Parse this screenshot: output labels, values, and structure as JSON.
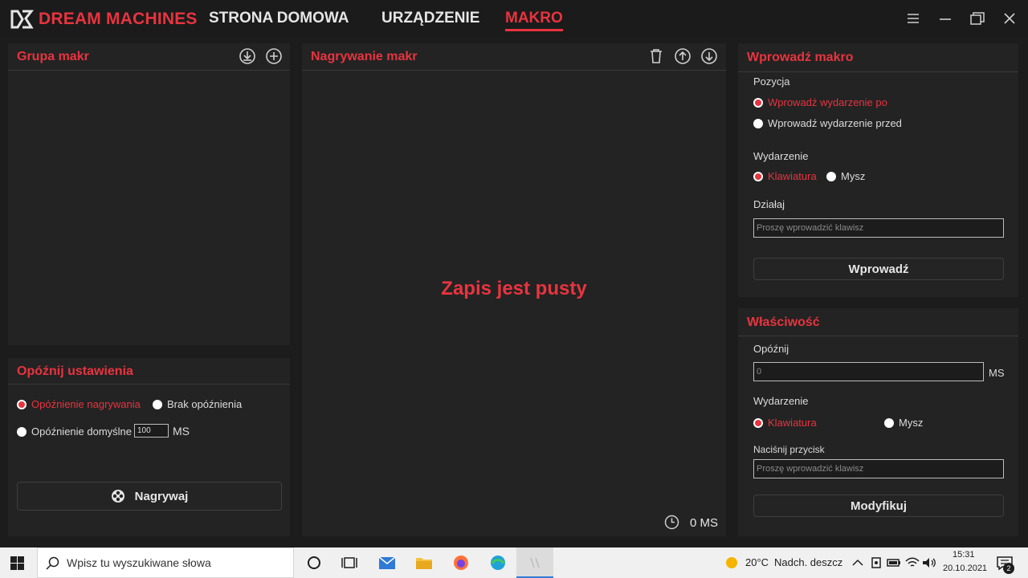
{
  "app": {
    "brand": "DREAM MACHINES",
    "nav": [
      "STRONA DOMOWA",
      "URZĄDZENIE",
      "MAKRO"
    ],
    "active_nav": "MAKRO"
  },
  "macro_group": {
    "title": "Grupa makr"
  },
  "delay_settings": {
    "title": "Opóźnij ustawienia",
    "opt_record_delay": "Opóźnienie nagrywania",
    "opt_no_delay": "Brak opóźnienia",
    "opt_default_delay": "Opóźnienie domyślne",
    "default_delay_value": "100",
    "unit": "MS",
    "record_button": "Nagrywaj"
  },
  "macro_recording": {
    "title": "Nagrywanie makr",
    "empty_message": "Zapis jest pusty",
    "time_value": "0 MS"
  },
  "insert_macro": {
    "title": "Wprowadź makro",
    "position_label": "Pozycja",
    "opt_after": "Wprowadź wydarzenie po",
    "opt_before": "Wprowadź wydarzenie przed",
    "event_label": "Wydarzenie",
    "opt_keyboard": "Klawiatura",
    "opt_mouse": "Mysz",
    "action_label": "Działaj",
    "key_placeholder": "Proszę wprowadzić klawisz",
    "insert_button": "Wprowadź"
  },
  "property": {
    "title": "Właściwość",
    "delay_label": "Opóźnij",
    "delay_value": "0",
    "unit": "MS",
    "event_label": "Wydarzenie",
    "opt_keyboard": "Klawiatura",
    "opt_mouse": "Mysz",
    "press_label": "Naciśnij przycisk",
    "key_placeholder": "Proszę wprowadzić klawisz",
    "modify_button": "Modyfikuj"
  },
  "taskbar": {
    "search_placeholder": "Wpisz tu wyszukiwane słowa",
    "weather_temp": "20°C",
    "weather_desc": "Nadch. deszcz",
    "time": "15:31",
    "date": "20.10.2021",
    "notifications": "2"
  },
  "colors": {
    "accent": "#e8343f",
    "panel": "#232323",
    "background": "#1c1c1c"
  }
}
